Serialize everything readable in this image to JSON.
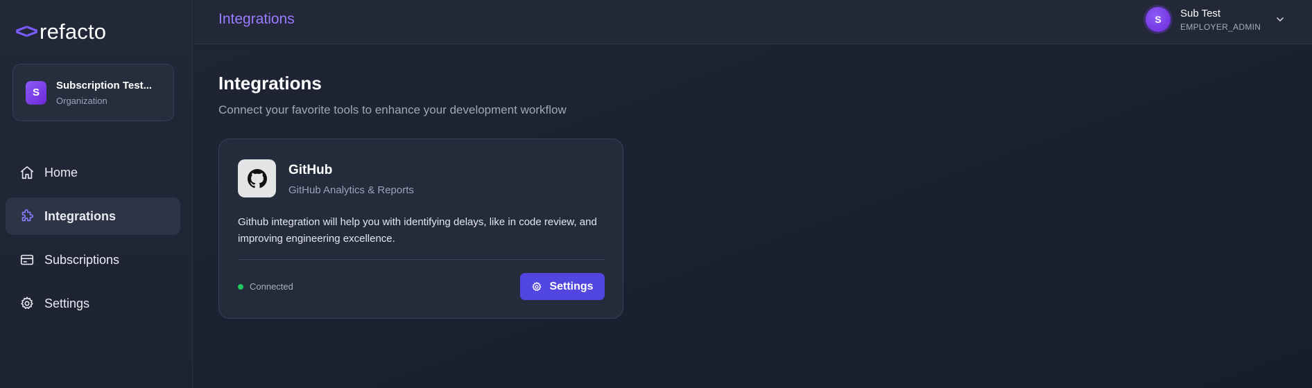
{
  "brand": {
    "mark": "<>",
    "name": "refacto"
  },
  "org": {
    "initial": "S",
    "name": "Subscription Test...",
    "role": "Organization"
  },
  "nav": {
    "items": [
      {
        "label": "Home",
        "icon": "home-icon",
        "active": false
      },
      {
        "label": "Integrations",
        "icon": "puzzle-icon",
        "active": true
      },
      {
        "label": "Subscriptions",
        "icon": "credit-card-icon",
        "active": false
      },
      {
        "label": "Settings",
        "icon": "gear-icon",
        "active": false
      }
    ]
  },
  "header": {
    "title": "Integrations",
    "user": {
      "initial": "S",
      "name": "Sub Test",
      "role": "EMPLOYER_ADMIN"
    }
  },
  "main": {
    "title": "Integrations",
    "subtitle": "Connect your favorite tools to enhance your development workflow",
    "integrations": [
      {
        "name": "GitHub",
        "subtitle": "GitHub Analytics & Reports",
        "description": "Github integration will help you with identifying delays, like in code review, and improving engineering excellence.",
        "status": "Connected",
        "button_label": "Settings"
      }
    ]
  },
  "colors": {
    "accent": "#7c5cff",
    "button": "#5147e0",
    "connected": "#22c55e",
    "background": "#1b2130"
  }
}
